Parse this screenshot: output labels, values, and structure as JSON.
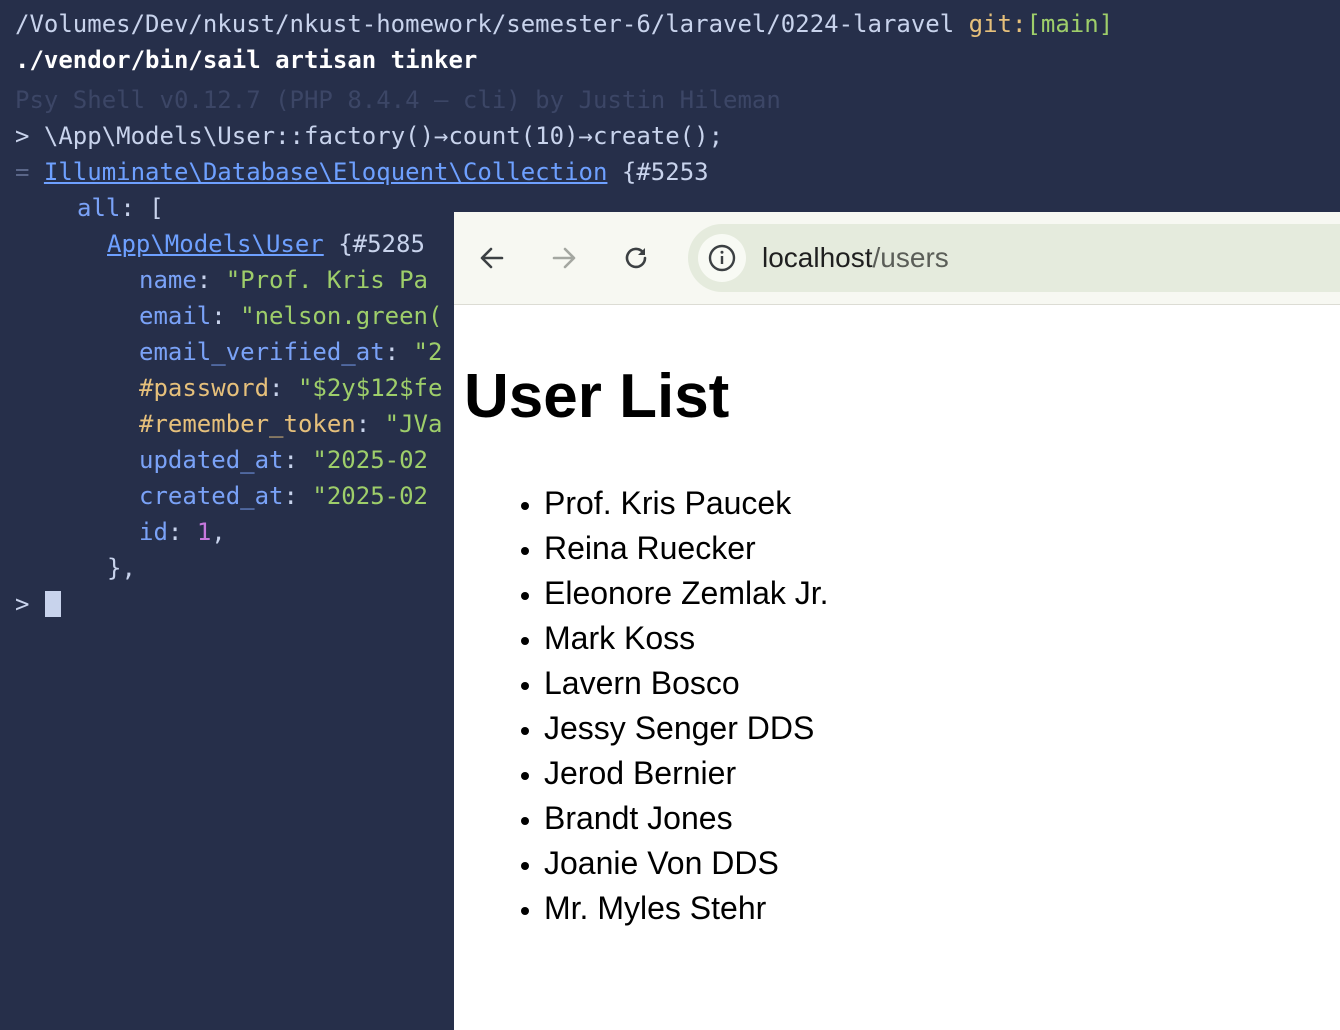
{
  "terminal": {
    "cwd_path": "/Volumes/Dev/nkust/nkust-homework/semester-6/laravel/0224-laravel",
    "git_label": "git:",
    "git_branch": "[main]",
    "command": "./vendor/bin/sail artisan tinker",
    "psy_banner": "Psy Shell v0.12.7 (PHP 8.4.4 — cli) by Justin Hileman",
    "prompt_symbol": ">",
    "input_line": "\\App\\Models\\User::factory()→count(10)→create();",
    "result_eq": "=",
    "collection_class": "Illuminate\\Database\\Eloquent\\Collection",
    "collection_ref": "{#5253",
    "all_key": "all",
    "all_punc": ": [",
    "user_class": "App\\Models\\User",
    "user_ref": "{#5285",
    "attrs": {
      "name_key": "name",
      "name_val": "\"Prof. Kris Pa",
      "email_key": "email",
      "email_val": "\"nelson.green(",
      "verified_key": "email_verified_at",
      "verified_val": "\"2",
      "password_key": "#password",
      "password_val": "\"$2y$12$fe",
      "token_key": "#remember_token",
      "token_val": "\"JVa",
      "updated_key": "updated_at",
      "updated_val": "\"2025-02",
      "created_key": "created_at",
      "created_val": "\"2025-02",
      "id_key": "id",
      "id_val": "1"
    },
    "close_brace": "},",
    "colon": ": ",
    "comma": ","
  },
  "browser": {
    "url_host": "localhost",
    "url_path": "/users",
    "page_title": "User List",
    "users": [
      "Prof. Kris Paucek",
      "Reina Ruecker",
      "Eleonore Zemlak Jr.",
      "Mark Koss",
      "Lavern Bosco",
      "Jessy Senger DDS",
      "Jerod Bernier",
      "Brandt Jones",
      "Joanie Von DDS",
      "Mr. Myles Stehr"
    ]
  }
}
